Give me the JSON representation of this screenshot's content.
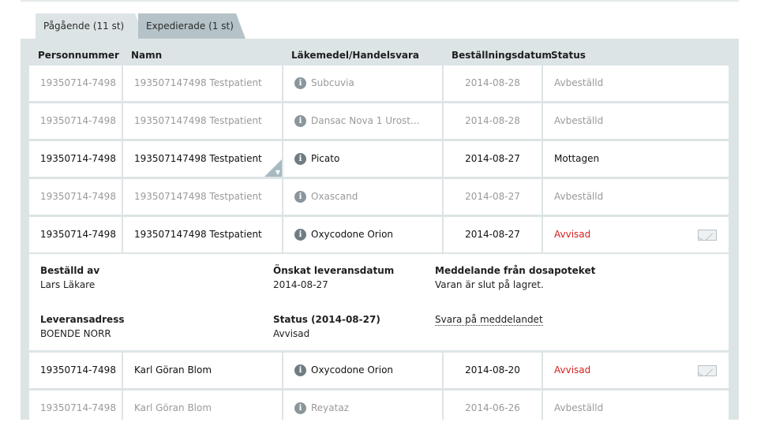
{
  "tabs": [
    {
      "label": "Pågående (11 st)",
      "active": true
    },
    {
      "label": "Expedierade (1 st)",
      "active": false
    }
  ],
  "columns": [
    "Personnummer",
    "Namn",
    "Läkemedel/Handelsvara",
    "Beställningsdatum",
    "Status"
  ],
  "rows": [
    {
      "pnr": "19350714-7498",
      "name": "193507147498 Testpatient",
      "product": "Subcuvia",
      "date": "2014-08-28",
      "status": "Avbeställd"
    },
    {
      "pnr": "19350714-7498",
      "name": "193507147498 Testpatient",
      "product": "Dansac Nova 1 Urost...",
      "date": "2014-08-28",
      "status": "Avbeställd"
    },
    {
      "pnr": "19350714-7498",
      "name": "193507147498 Testpatient",
      "product": "Picato",
      "date": "2014-08-27",
      "status": "Mottagen"
    },
    {
      "pnr": "19350714-7498",
      "name": "193507147498 Testpatient",
      "product": "Oxascand",
      "date": "2014-08-27",
      "status": "Avbeställd"
    },
    {
      "pnr": "19350714-7498",
      "name": "193507147498 Testpatient",
      "product": "Oxycodone Orion",
      "date": "2014-08-27",
      "status": "Avvisad"
    },
    {
      "pnr": "19350714-7498",
      "name": "Karl Göran Blom",
      "product": "Oxycodone Orion",
      "date": "2014-08-20",
      "status": "Avvisad"
    },
    {
      "pnr": "19350714-7498",
      "name": "Karl Göran Blom",
      "product": "Reyataz",
      "date": "2014-06-26",
      "status": "Avbeställd"
    }
  ],
  "detail": {
    "ordered_by_label": "Beställd av",
    "ordered_by_value": "Lars Läkare",
    "delivery_date_label": "Önskat leveransdatum",
    "delivery_date_value": "2014-08-27",
    "message_label": "Meddelande från dosapoteket",
    "message_value": "Varan är slut på lagret.",
    "address_label": "Leveransadress",
    "address_value": "BOENDE NORR",
    "status_label": "Status (2014-08-27)",
    "status_value": "Avvisad",
    "reply_link": "Svara på meddelandet"
  },
  "icons": {
    "info": "i",
    "corner": "▼"
  },
  "colors": {
    "panel": "#dde4e6",
    "tab_inactive": "#b5c3c8",
    "status_rejected": "#d42020",
    "muted_text": "#9a9a9a"
  }
}
